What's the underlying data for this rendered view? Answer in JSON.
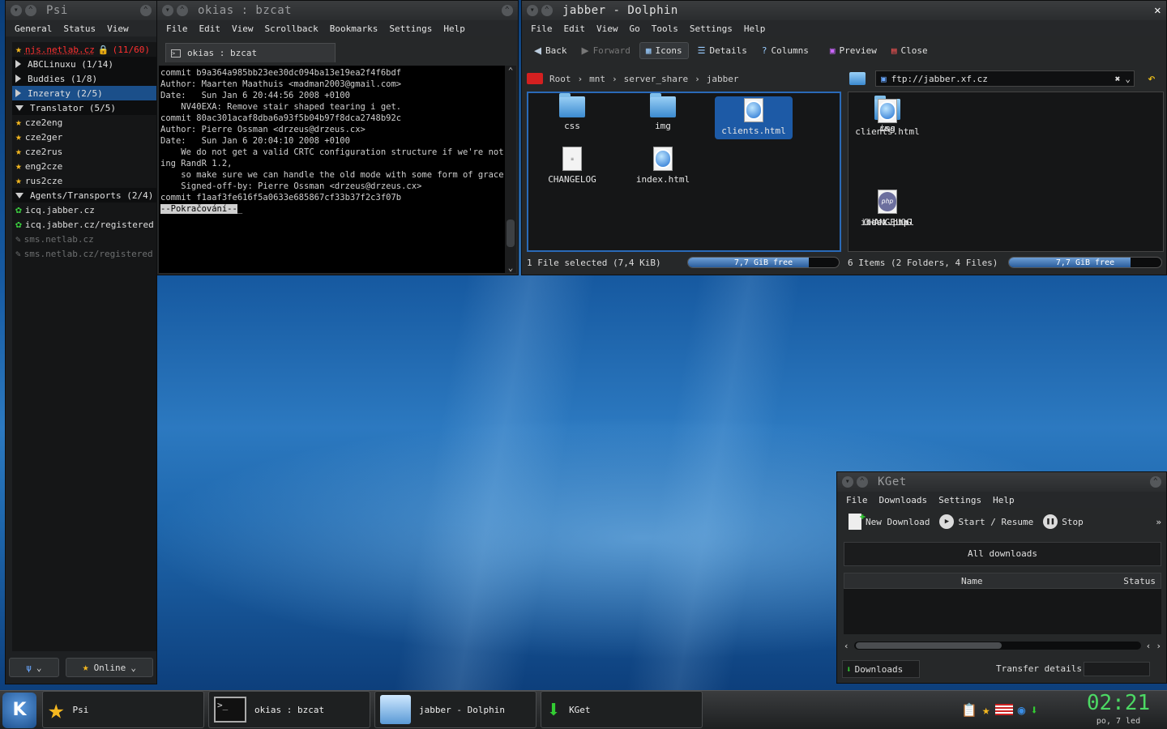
{
  "psi": {
    "title": "Psi",
    "menu": [
      "General",
      "Status",
      "View"
    ],
    "account": {
      "name": "njs.netlab.cz",
      "count": "(11/60)"
    },
    "items": [
      {
        "type": "group",
        "label": "ABCLinuxu (1/14)",
        "open": false
      },
      {
        "type": "group",
        "label": "Buddies (1/8)",
        "open": false
      },
      {
        "type": "group",
        "label": "Inzeraty (2/5)",
        "open": false,
        "selected": true
      },
      {
        "type": "group",
        "label": "Translator (5/5)",
        "open": true
      },
      {
        "type": "contact",
        "label": "cze2eng",
        "icon": "star"
      },
      {
        "type": "contact",
        "label": "cze2ger",
        "icon": "star"
      },
      {
        "type": "contact",
        "label": "cze2rus",
        "icon": "star"
      },
      {
        "type": "contact",
        "label": "eng2cze",
        "icon": "star"
      },
      {
        "type": "contact",
        "label": "rus2cze",
        "icon": "star"
      },
      {
        "type": "group",
        "label": "Agents/Transports (2/4)",
        "open": true
      },
      {
        "type": "contact",
        "label": "icq.jabber.cz",
        "icon": "icq"
      },
      {
        "type": "contact",
        "label": "icq.jabber.cz/registered",
        "icon": "icq"
      },
      {
        "type": "offline",
        "label": "sms.netlab.cz",
        "icon": "offline"
      },
      {
        "type": "offline",
        "label": "sms.netlab.cz/registered",
        "icon": "offline"
      }
    ],
    "status_label": "Online"
  },
  "term": {
    "title": "okias : bzcat",
    "menu": [
      "File",
      "Edit",
      "View",
      "Scrollback",
      "Bookmarks",
      "Settings",
      "Help"
    ],
    "tab": "okias : bzcat",
    "lines": [
      "commit b9a364a985bb23ee30dc094ba13e19ea2f4f6bdf",
      "Author: Maarten Maathuis <madman2003@gmail.com>",
      "Date:   Sun Jan 6 20:44:56 2008 +0100",
      "",
      "    NV40EXA: Remove stair shaped tearing i get.",
      "",
      "commit 80ac301acaf8dba6a93f5b04b97f8dca2748b92c",
      "Author: Pierre Ossman <drzeus@drzeus.cx>",
      "Date:   Sun Jan 6 20:04:10 2008 +0100",
      "",
      "    We do not get a valid CRTC configuration structure if we're not us",
      "ing RandR 1.2,",
      "    so make sure we can handle the old mode with some form of grace.",
      "",
      "    Signed-off-by: Pierre Ossman <drzeus@drzeus.cx>",
      "",
      "commit f1aaf3fe616f5a0633e685867cf33b37f2c3f07b"
    ],
    "prompt": "--Pokračování--"
  },
  "dolphin": {
    "title": "jabber - Dolphin",
    "menu": [
      "File",
      "Edit",
      "View",
      "Go",
      "Tools",
      "Settings",
      "Help"
    ],
    "toolbar": {
      "back": "Back",
      "forward": "Forward",
      "icons": "Icons",
      "details": "Details",
      "columns": "Columns",
      "preview": "Preview",
      "close": "Close"
    },
    "breadcrumb": [
      "Root",
      "mnt",
      "server_share",
      "jabber"
    ],
    "url": "ftp://jabber.xf.cz",
    "left_files": [
      {
        "name": "css",
        "kind": "folder"
      },
      {
        "name": "img",
        "kind": "folder"
      },
      {
        "name": "clients.html",
        "kind": "html",
        "selected": true
      },
      {
        "name": "CHANGELOG",
        "kind": "text"
      },
      {
        "name": "index.html",
        "kind": "html"
      }
    ],
    "right_files": [
      {
        "name": "css",
        "kind": "folder"
      },
      {
        "name": "img",
        "kind": "folder"
      },
      {
        "name": "clients.html",
        "kind": "html"
      },
      {
        "name": "CHANGELOG",
        "kind": "binary"
      },
      {
        "name": "index.html",
        "kind": "html"
      },
      {
        "name": "test.php",
        "kind": "php"
      }
    ],
    "left_status": "1 File selected (7,4 KiB)",
    "right_status": "6 Items (2 Folders, 4 Files)",
    "free": "7,7 GiB free",
    "free_fraction": 0.8
  },
  "kget": {
    "title": "KGet",
    "menu": [
      "File",
      "Downloads",
      "Settings",
      "Help"
    ],
    "toolbar": {
      "new": "New Download",
      "start": "Start / Resume",
      "stop": "Stop"
    },
    "all": "All downloads",
    "columns": [
      "Name",
      "Status"
    ],
    "downloads_tab": "Downloads",
    "transfer_label": "Transfer details:"
  },
  "taskbar": {
    "tasks": [
      "Psi",
      "okias : bzcat",
      "jabber - Dolphin",
      "KGet"
    ],
    "clock": "02:21",
    "date": "po, 7 led"
  },
  "colors": {
    "accent": "#1b4f8a",
    "selection": "#1d5aa6",
    "clock": "#4cd964",
    "account": "#ff3030"
  }
}
